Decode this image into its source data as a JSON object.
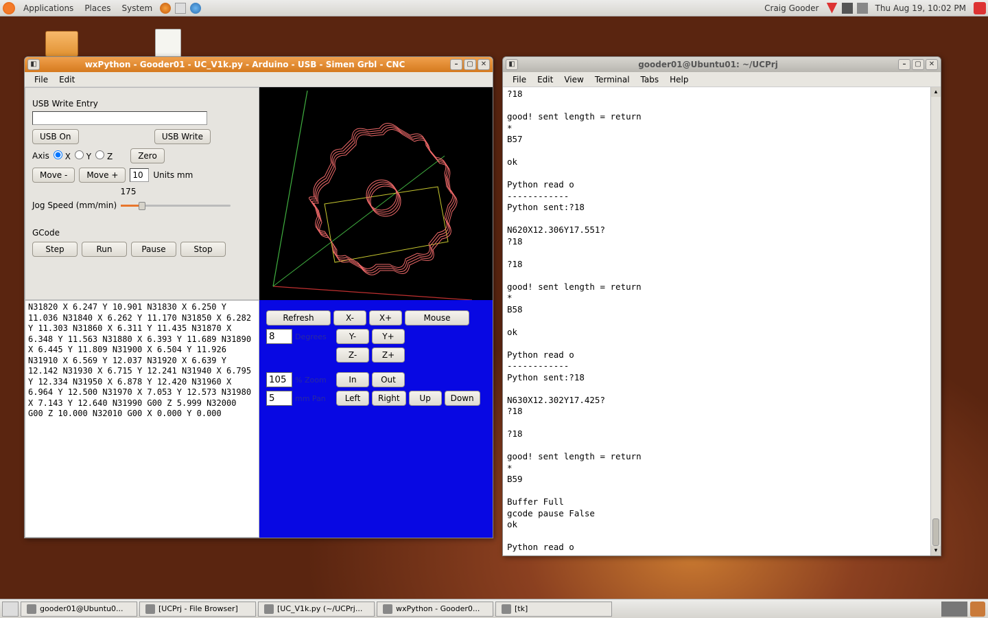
{
  "top_panel": {
    "menus": {
      "applications": "Applications",
      "places": "Places",
      "system": "System"
    },
    "user": "Craig Gooder",
    "datetime": "Thu Aug 19, 10:02 PM"
  },
  "desktop_icons": {
    "folder_label": "",
    "file_label": ""
  },
  "cnc_window": {
    "title": "wxPython - Gooder01 - UC_V1k.py - Arduino - USB - Simen Grbl - CNC",
    "menubar": {
      "file": "File",
      "edit": "Edit"
    },
    "usb_section": {
      "label": "USB Write Entry",
      "entry_value": "",
      "usb_on": "USB On",
      "usb_write": "USB Write"
    },
    "axis_section": {
      "label": "Axis",
      "x": "X",
      "y": "Y",
      "z": "Z",
      "selected": "X",
      "zero": "Zero"
    },
    "move_section": {
      "minus": "Move -",
      "plus": "Move +",
      "dist_value": "10",
      "units": "Units mm"
    },
    "jog_section": {
      "label": "Jog Speed (mm/min)",
      "value": "175"
    },
    "gcode_section": {
      "label": "GCode",
      "step": "Step",
      "run": "Run",
      "pause": "Pause",
      "stop": "Stop"
    },
    "gcode_list": [
      "N31820 X 6.247 Y 10.901",
      "N31830 X 6.250 Y 11.036",
      "N31840 X 6.262 Y 11.170",
      "N31850 X 6.282 Y 11.303",
      "N31860 X 6.311 Y 11.435",
      "N31870 X 6.348 Y 11.563",
      "N31880 X 6.393 Y 11.689",
      "N31890 X 6.445 Y 11.809",
      "N31900 X 6.504 Y 11.926",
      "N31910 X 6.569 Y 12.037",
      "N31920 X 6.639 Y 12.142",
      "N31930 X 6.715 Y 12.241",
      "N31940 X 6.795 Y 12.334",
      "N31950 X 6.878 Y 12.420",
      "N31960 X 6.964 Y 12.500",
      "N31970 X 7.053 Y 12.573",
      "N31980 X 7.143 Y 12.640",
      "N31990 G00   Z 5.999",
      "N32000 G00 Z 10.000",
      "N32010 G00 X 0.000 Y 0.000"
    ],
    "view_panel": {
      "refresh": "Refresh",
      "x_minus": "X-",
      "x_plus": "X+",
      "mouse": "Mouse",
      "degrees_value": "8",
      "degrees_label": "Degrees",
      "y_minus": "Y-",
      "y_plus": "Y+",
      "z_minus": "Z-",
      "z_plus": "Z+",
      "zoom_value": "105",
      "zoom_label": "% Zoom",
      "in": "In",
      "out": "Out",
      "pan_value": "5",
      "pan_label": "mm Pan",
      "left": "Left",
      "right": "Right",
      "up": "Up",
      "down": "Down"
    }
  },
  "terminal_window": {
    "title": "gooder01@Ubuntu01: ~/UCPrj",
    "menubar": {
      "file": "File",
      "edit": "Edit",
      "view": "View",
      "terminal": "Terminal",
      "tabs": "Tabs",
      "help": "Help"
    },
    "content": "?18\n\ngood! sent length = return\n*\nB57\n\nok\n\nPython read o\n------------\nPython sent:?18\n\nN620X12.306Y17.551?\n?18\n\n?18\n\ngood! sent length = return\n*\nB58\n\nok\n\nPython read o\n------------\nPython sent:?18\n\nN630X12.302Y17.425?\n?18\n\n?18\n\ngood! sent length = return\n*\nB59\n\nBuffer Full\ngcode pause False\nok\n\nPython read o\n▯"
  },
  "taskbar": {
    "tasks": [
      "gooder01@Ubuntu0...",
      "[UCPrj - File Browser]",
      "[UC_V1k.py (~/UCPrj...",
      "wxPython - Gooder0...",
      "[tk]"
    ]
  }
}
